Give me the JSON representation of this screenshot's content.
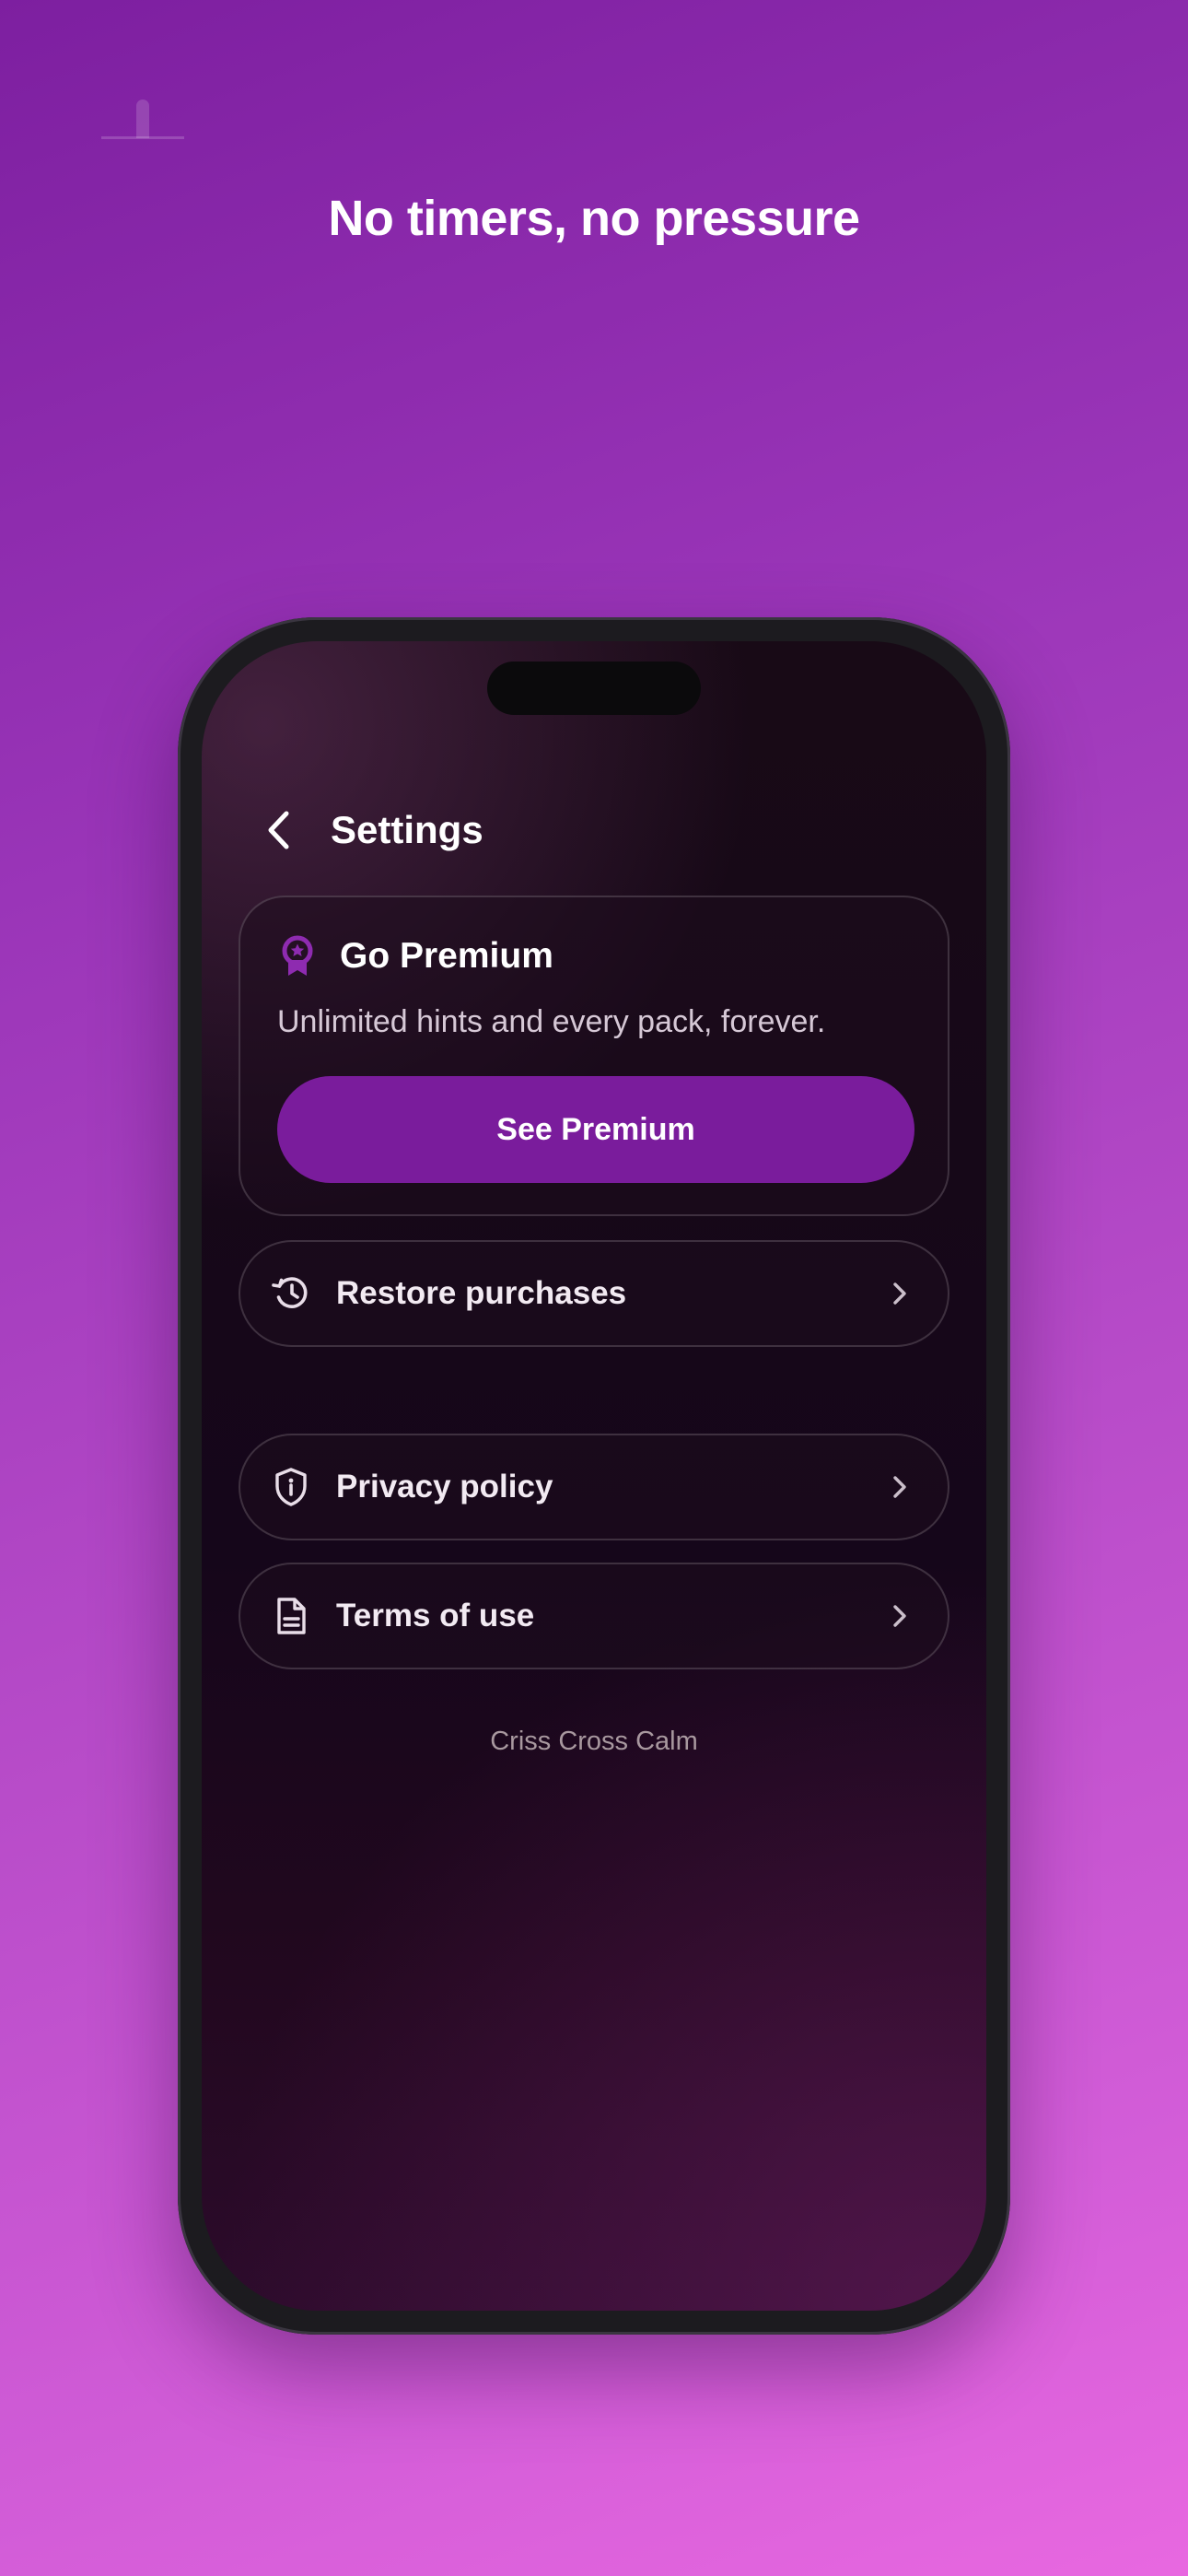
{
  "promo": {
    "headline": "No timers, no pressure"
  },
  "settings": {
    "title": "Settings",
    "premium_card": {
      "title": "Go Premium",
      "subtitle": "Unlimited hints and every pack, forever.",
      "button_label": "See Premium"
    },
    "rows": {
      "restore": {
        "label": "Restore purchases",
        "icon": "restore-clock-icon"
      },
      "privacy": {
        "label": "Privacy policy",
        "icon": "shield-info-icon"
      },
      "terms": {
        "label": "Terms of use",
        "icon": "document-icon"
      }
    },
    "footer": "Criss Cross Calm"
  },
  "colors": {
    "accent": "#7a1c9c",
    "background_top": "#7d1fa0",
    "background_bottom": "#e868e0",
    "screen_bg": "#15061a"
  }
}
